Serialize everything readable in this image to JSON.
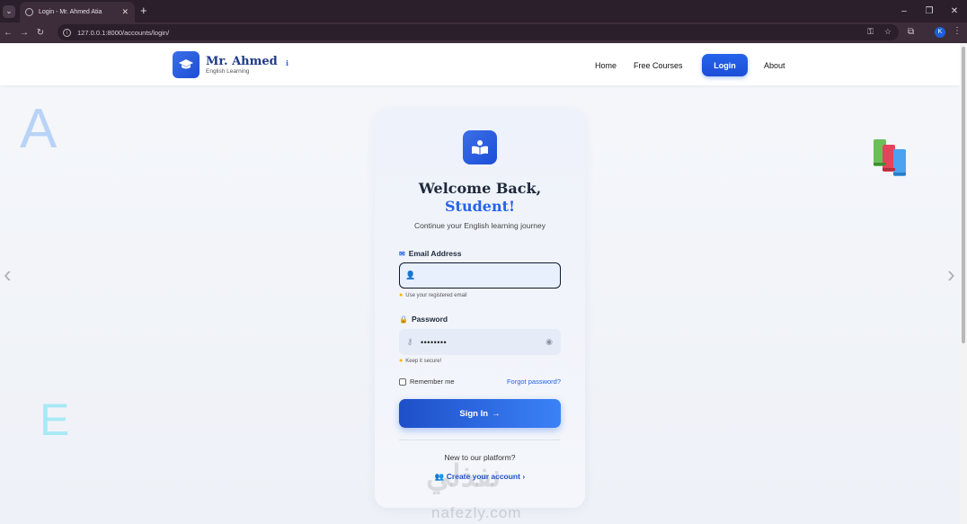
{
  "browser": {
    "tab_title": "Login - Mr. Ahmed Atia",
    "url": "127.0.0.1:8000/accounts/login/",
    "profile_initial": "K"
  },
  "navbar": {
    "brand": "Mr. Ahmed",
    "brand_sub": "English Learning",
    "menu": {
      "home": "Home",
      "courses": "Free Courses",
      "login": "Login",
      "about": "About"
    }
  },
  "decor": {
    "letter_a": "A",
    "letter_e": "E"
  },
  "login": {
    "title_line1": "Welcome Back,",
    "title_line2": "Student!",
    "subtitle": "Continue your English learning journey",
    "email_label": "Email Address",
    "email_value": "",
    "email_hint": "Use your registered email",
    "password_label": "Password",
    "password_value": "••••••••",
    "password_hint": "Keep it secure!",
    "remember": "Remember me",
    "forgot": "Forgot password?",
    "signin": "Sign In",
    "new_question": "New to our platform?",
    "create": "Create your account"
  },
  "watermark": {
    "arabic": "نفذلي",
    "latin": "nafezly.com"
  },
  "colors": {
    "primary": "#2563eb",
    "dark": "#1e293b",
    "accent_yellow": "#f5b300"
  }
}
